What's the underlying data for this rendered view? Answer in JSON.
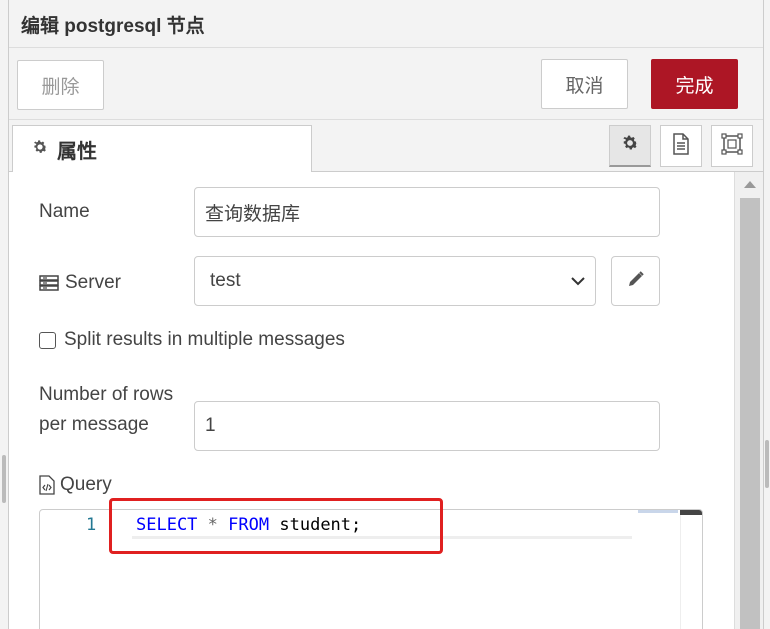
{
  "header": {
    "title": "编辑 postgresql 节点"
  },
  "toolbar": {
    "delete_label": "删除",
    "cancel_label": "取消",
    "done_label": "完成"
  },
  "tabs": {
    "properties_label": "属性"
  },
  "form": {
    "name_label": "Name",
    "name_value": "查询数据库",
    "server_label": "Server",
    "server_value": "test",
    "split_label": "Split results in multiple messages",
    "split_checked": false,
    "rows_label_line1": "Number of rows",
    "rows_label_line2": "per message",
    "rows_value": "1",
    "query_label": "Query"
  },
  "editor": {
    "line_number": "1",
    "tokens": {
      "select": "SELECT",
      "star": "*",
      "from": "FROM",
      "table": "student;"
    }
  },
  "colors": {
    "accent": "#ad1625",
    "highlight": "#e02020",
    "keyword": "#0000ff"
  }
}
